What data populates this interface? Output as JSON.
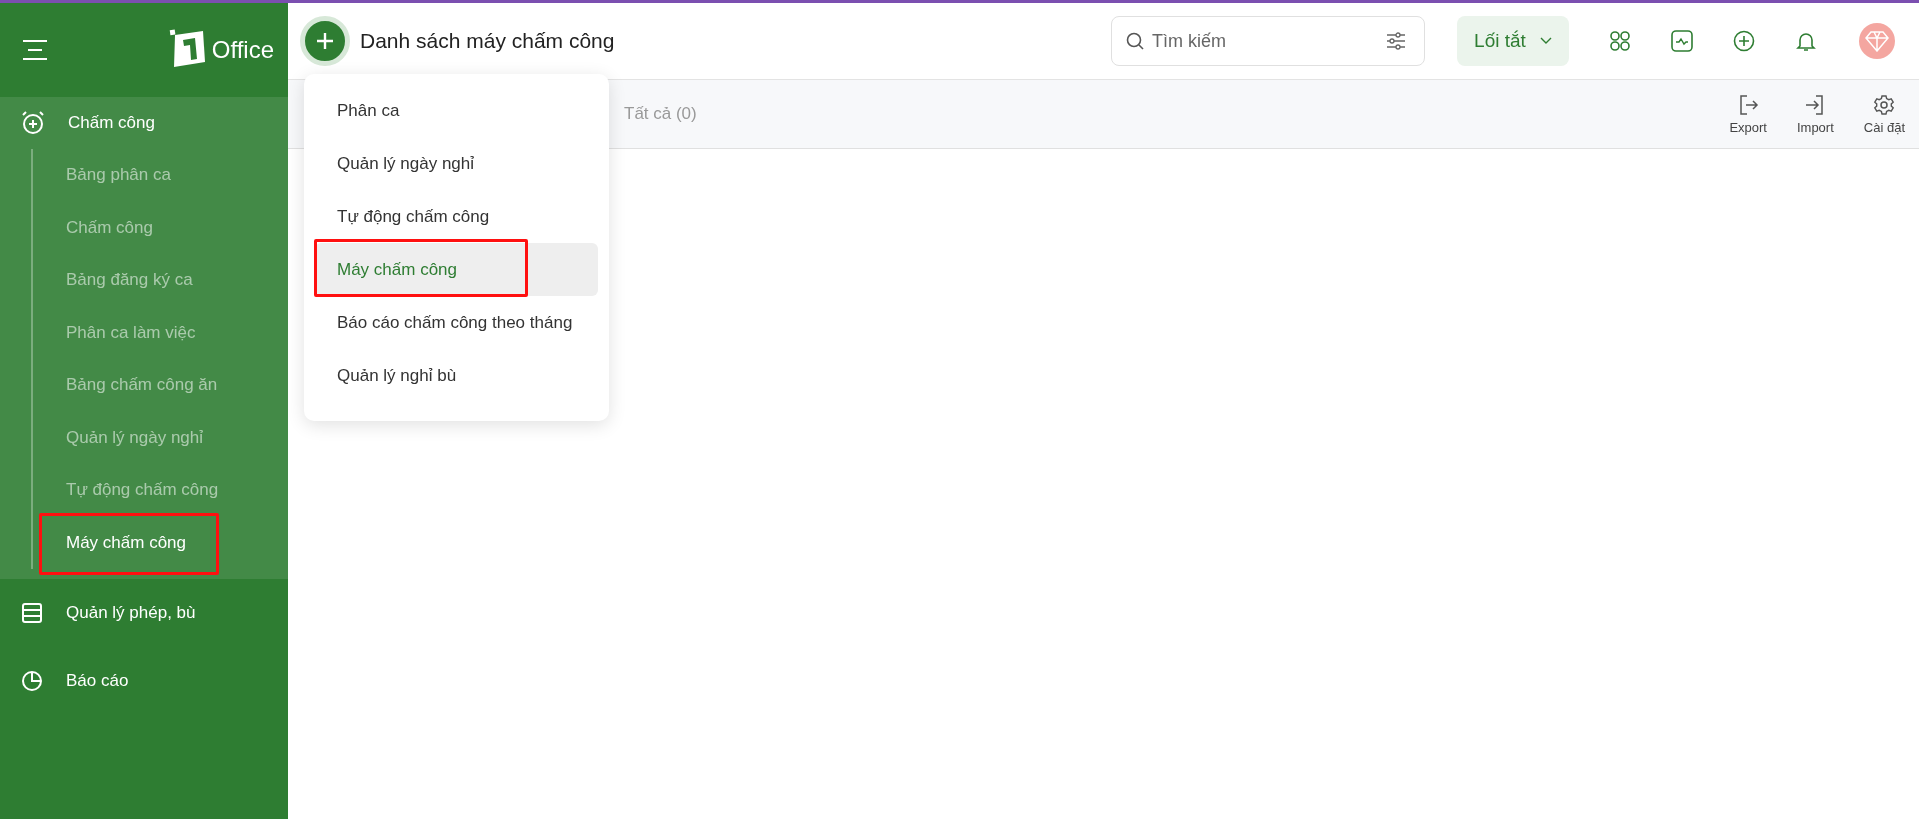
{
  "sidebar": {
    "logo": {
      "text": "Office"
    },
    "groups": [
      {
        "label": "Chấm công",
        "expanded": true,
        "children": [
          {
            "label": "Bảng phân ca",
            "selected": false,
            "annotated": false
          },
          {
            "label": "Chấm công",
            "selected": false,
            "annotated": false
          },
          {
            "label": "Bảng đăng ký ca",
            "selected": false,
            "annotated": false
          },
          {
            "label": "Phân ca làm việc",
            "selected": false,
            "annotated": false
          },
          {
            "label": "Bảng chấm công ăn",
            "selected": false,
            "annotated": false
          },
          {
            "label": "Quản lý ngày nghỉ",
            "selected": false,
            "annotated": false
          },
          {
            "label": "Tự động chấm công",
            "selected": false,
            "annotated": false
          },
          {
            "label": "Máy chấm công",
            "selected": true,
            "annotated": true
          }
        ]
      },
      {
        "label": "Quản lý phép, bù",
        "expanded": false
      },
      {
        "label": "Báo cáo",
        "expanded": false
      }
    ]
  },
  "header": {
    "title": "Danh sách máy chấm công",
    "search": {
      "placeholder": "Tìm kiếm"
    },
    "shortcut_button": "Lối tắt"
  },
  "toolbar": {
    "tab": "Tất cả (0)",
    "actions": [
      {
        "label": "Export"
      },
      {
        "label": "Import"
      },
      {
        "label": "Cài đặt"
      }
    ]
  },
  "dropdown": {
    "items": [
      {
        "label": "Phân ca",
        "selected": false,
        "annotated": false
      },
      {
        "label": "Quản lý ngày nghỉ",
        "selected": false,
        "annotated": false
      },
      {
        "label": "Tự động chấm công",
        "selected": false,
        "annotated": false
      },
      {
        "label": "Máy chấm công",
        "selected": true,
        "annotated": true
      },
      {
        "label": "Báo cáo chấm công theo tháng",
        "selected": false,
        "annotated": false
      },
      {
        "label": "Quản lý nghỉ bù",
        "selected": false,
        "annotated": false
      }
    ]
  }
}
